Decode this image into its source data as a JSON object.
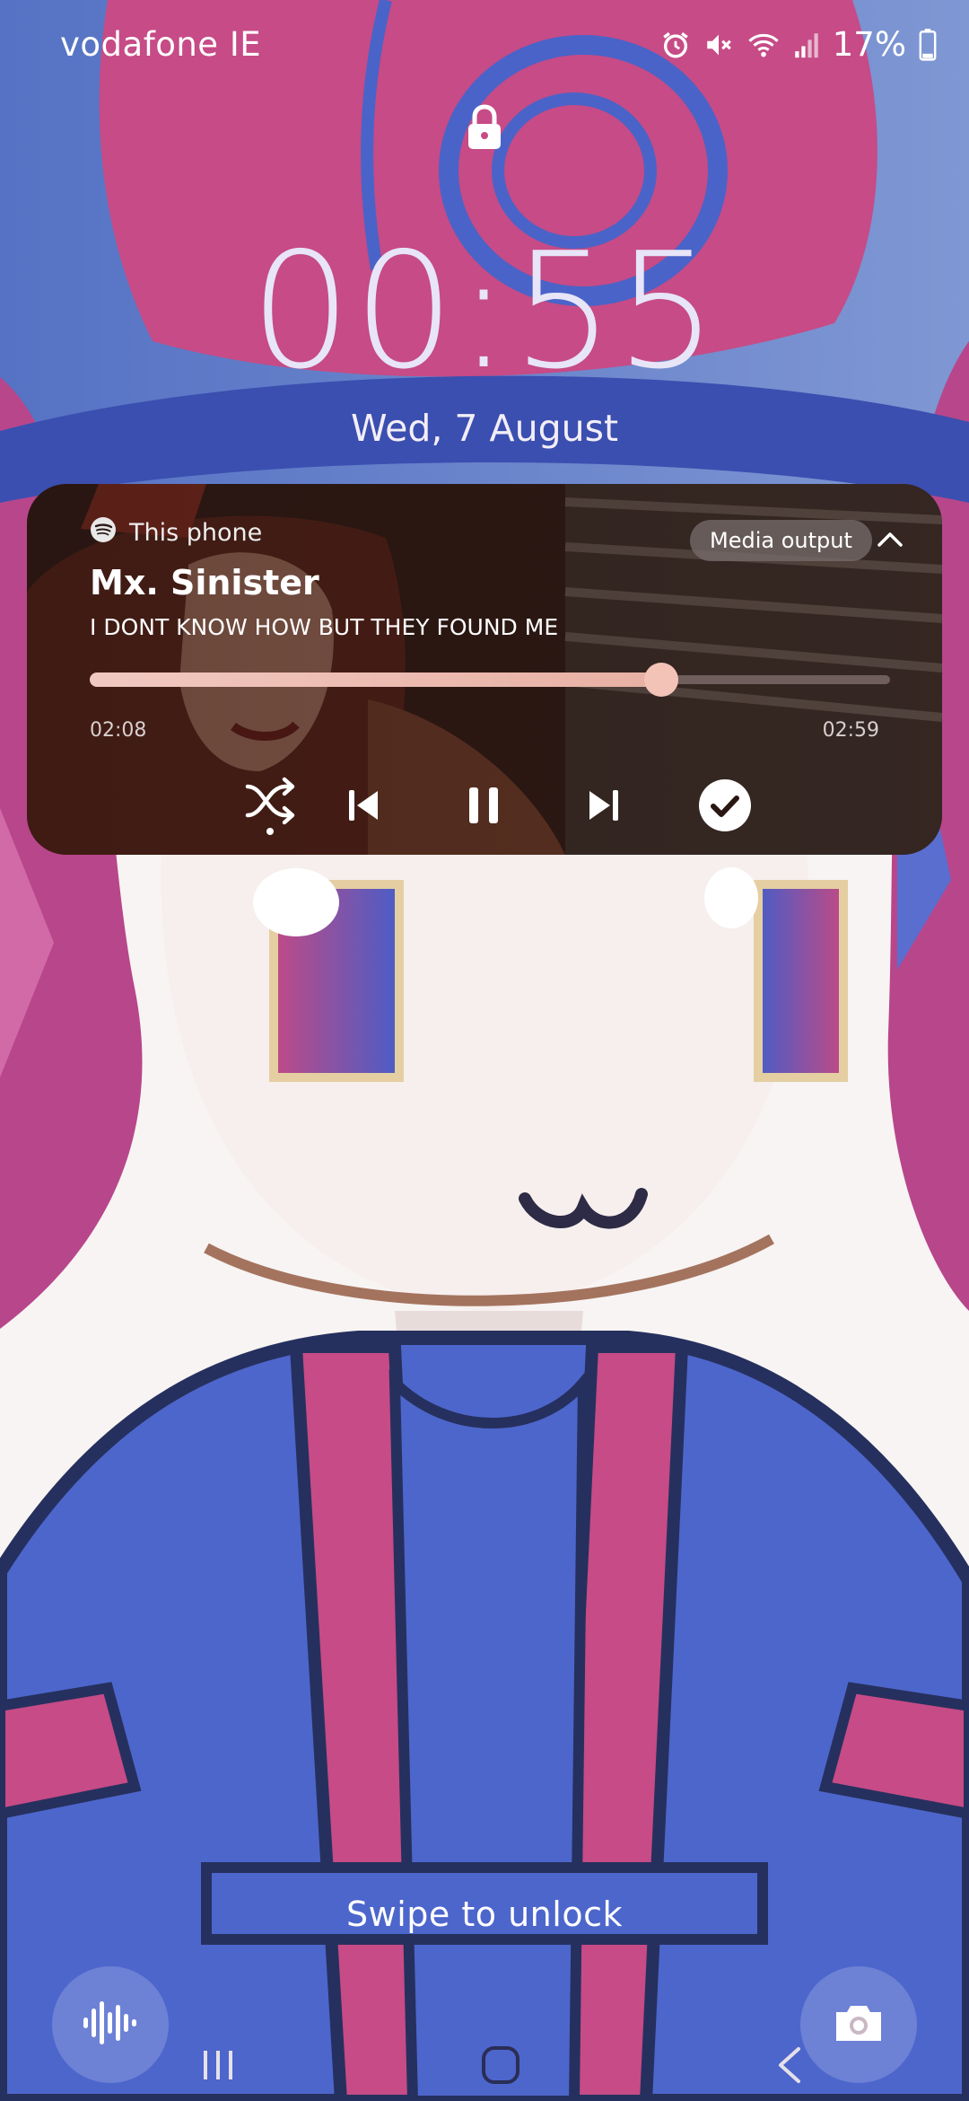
{
  "status_bar": {
    "carrier": "vodafone IE",
    "battery": "17%",
    "icons": [
      "alarm-icon",
      "mute-icon",
      "wifi-icon",
      "signal-icon",
      "battery-icon"
    ]
  },
  "lockscreen": {
    "time": "00:55",
    "date": "Wed, 7 August",
    "swipe_hint": "Swipe to unlock"
  },
  "media": {
    "source": "This phone",
    "source_icon": "spotify-icon",
    "output_button": "Media output",
    "title": "Mx. Sinister",
    "artist": "I DONT KNOW HOW BUT THEY FOUND ME",
    "elapsed": "02:08",
    "total": "02:59",
    "progress": 0.714,
    "controls": [
      "shuffle-icon",
      "previous-icon",
      "pause-icon",
      "next-icon",
      "liked-check-icon"
    ]
  },
  "shortcuts": {
    "left": "voice-assistant-icon",
    "right": "camera-icon"
  },
  "colors": {
    "clock": "#e7e5f7",
    "progress_fill": "#f1c9c0",
    "wallpaper_pink": "#c34d86",
    "wallpaper_blue": "#4a63c8"
  }
}
